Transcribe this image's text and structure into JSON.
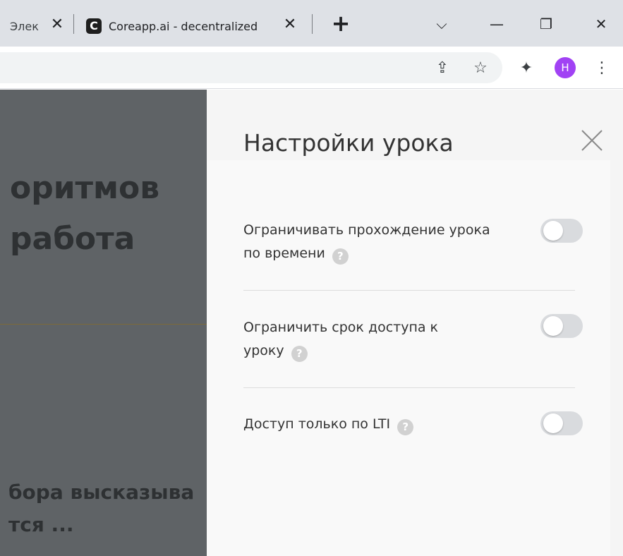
{
  "browser": {
    "tabs": [
      {
        "title": "Элек",
        "close": "✕"
      },
      {
        "title": "Coreapp.ai - decentralized",
        "favicon": "C",
        "close": "✕"
      }
    ],
    "new_tab": "+",
    "window": {
      "tab_search": "⌵",
      "minimize": "—",
      "restore": "❐",
      "close": "✕"
    },
    "toolbar": {
      "share": "⇪",
      "bookmark": "☆",
      "extensions": "✦",
      "avatar_letter": "H",
      "menu": "⋮"
    }
  },
  "backdrop": {
    "line1": "оритмов",
    "line2": "работа",
    "line3": "бора высказыва",
    "line4": "тся ..."
  },
  "panel": {
    "title": "Настройки урока",
    "settings": [
      {
        "label": "Ограничивать прохождение урока по времени",
        "help": "?",
        "enabled": false
      },
      {
        "label": "Ограничить срок доступа к уроку",
        "help": "?",
        "enabled": false
      },
      {
        "label": "Доступ только по LTI",
        "help": "?",
        "enabled": false
      }
    ]
  }
}
